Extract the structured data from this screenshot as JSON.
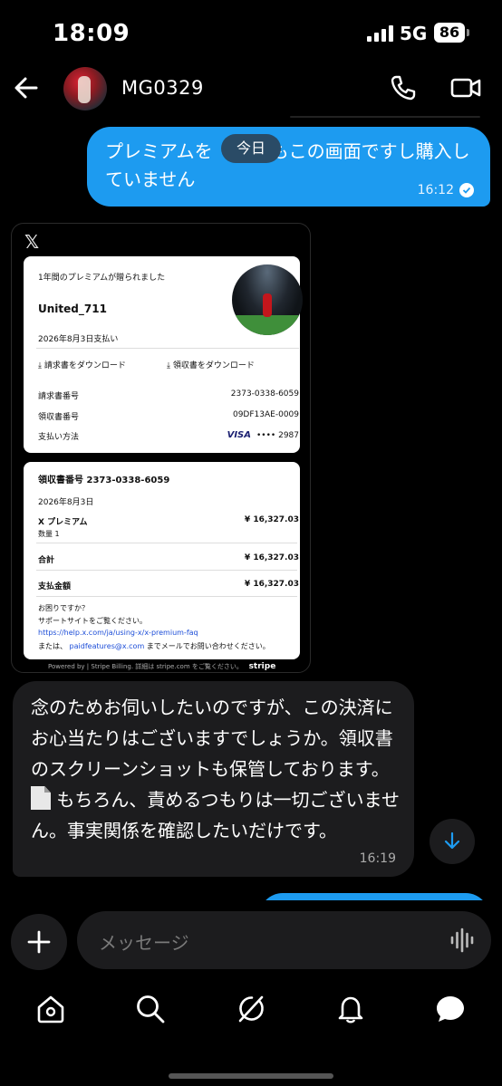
{
  "status_bar": {
    "time": "18:09",
    "network": "5G",
    "battery": "86"
  },
  "header": {
    "name": "MG0329"
  },
  "messages": {
    "outgoing_1": {
      "text": "プレミアムを購入してもこの画面ですし購入していません",
      "visible_text_a": "プレミアムを",
      "visible_text_b": "もこの画面ですし購入していません",
      "time": "16:12"
    },
    "date_pill": "今日",
    "receipt_image": {
      "x_logo": "𝕏",
      "gift_text": "1年間のプレミアムが贈られました",
      "user": "United_711",
      "pay_date": "2026年8月3日支払い",
      "download_invoice": "請求書をダウンロード",
      "download_receipt": "領収書をダウンロード",
      "invoice_no_label": "請求書番号",
      "invoice_no": "2373-0338-6059",
      "receipt_no_label": "領収書番号",
      "receipt_no": "09DF13AE-0009",
      "payment_method_label": "支払い方法",
      "card_brand": "VISA",
      "card_last4": "•••• 2987",
      "receipt_title": "領収書番号 2373-0338-6059",
      "receipt_date": "2026年8月3日",
      "item_name": "X プレミアム",
      "item_qty": "数量 1",
      "item_price": "¥ 16,327.03",
      "total_label": "合計",
      "total": "¥ 16,327.03",
      "paid_label": "支払金額",
      "paid": "¥ 16,327.03",
      "help_q": "お困りですか？",
      "help_site": "サポートサイトをご覧ください。",
      "help_url": "https://help.x.com/ja/using-x/x-premium-faq",
      "mail_pre": "または、",
      "mail": "paidfeatures@x.com",
      "mail_post": "までメールでお問い合わせください。",
      "powered": "Powered by  |  Stripe Billing. 詳細は stripe.com をご覧ください。",
      "stripe": "stripe"
    },
    "incoming_1": {
      "text_a": "念のためお伺いしたいのですが、この決済にお心当たりはございますでしょうか。領収書のスクリーンショットも保管しております。",
      "text_b": "もちろん、責めるつもりは一切ございません。事実関係を確認したいだけです。",
      "time": "16:19"
    }
  },
  "composer": {
    "placeholder": "メッセージ"
  },
  "nav": [
    "home-icon",
    "search-icon",
    "grok-icon",
    "notifications-icon",
    "messages-icon"
  ]
}
